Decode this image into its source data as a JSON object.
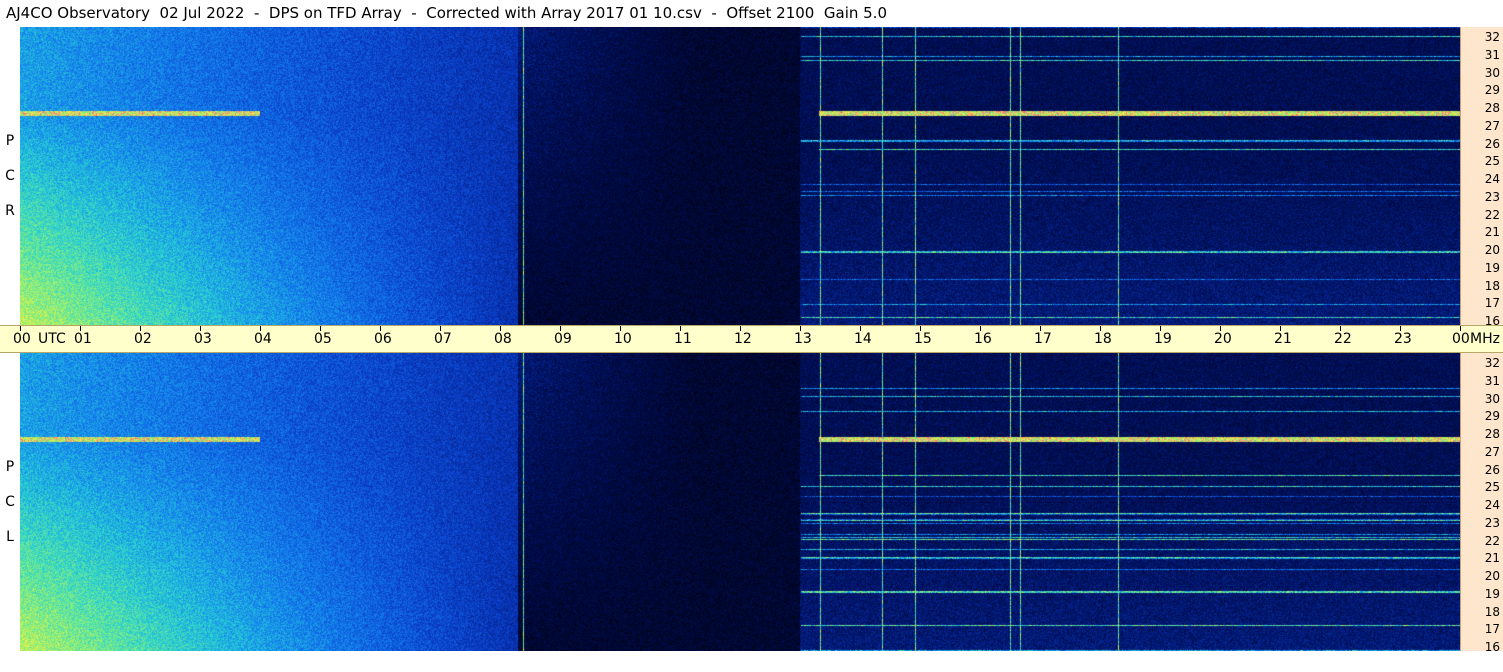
{
  "title": "AJ4CO Observatory  02 Jul 2022  -  DPS on TFD Array  -  Corrected with Array 2017 01 10.csv  -  Offset 2100  Gain 5.0",
  "panels": [
    {
      "id": "rcp",
      "letters": [
        "P",
        "C",
        "R"
      ]
    },
    {
      "id": "lcp",
      "letters": [
        "P",
        "C",
        "L"
      ]
    }
  ],
  "chart_data": {
    "type": "heatmap",
    "title": "AJ4CO Observatory  02 Jul 2022  -  DPS on TFD Array  -  Corrected with Array 2017 01 10.csv  -  Offset 2100  Gain 5.0",
    "x": {
      "ticks": [
        "00",
        "01",
        "02",
        "03",
        "04",
        "05",
        "06",
        "07",
        "08",
        "09",
        "10",
        "11",
        "12",
        "13",
        "14",
        "15",
        "16",
        "17",
        "18",
        "19",
        "20",
        "21",
        "22",
        "23",
        "00"
      ],
      "range": [
        0,
        24
      ],
      "start_label": "00",
      "utc_label": "UTC",
      "end_label": "00",
      "mhz_label": "MHz"
    },
    "y": {
      "ticks": [
        "32",
        "31",
        "30",
        "29",
        "28",
        "27",
        "26",
        "25",
        "24",
        "23",
        "22",
        "21",
        "20",
        "19",
        "18",
        "17",
        "16"
      ],
      "range": [
        16,
        32
      ]
    },
    "series": [
      {
        "name": "R C P"
      },
      {
        "name": "L C P"
      }
    ],
    "grid": false
  }
}
